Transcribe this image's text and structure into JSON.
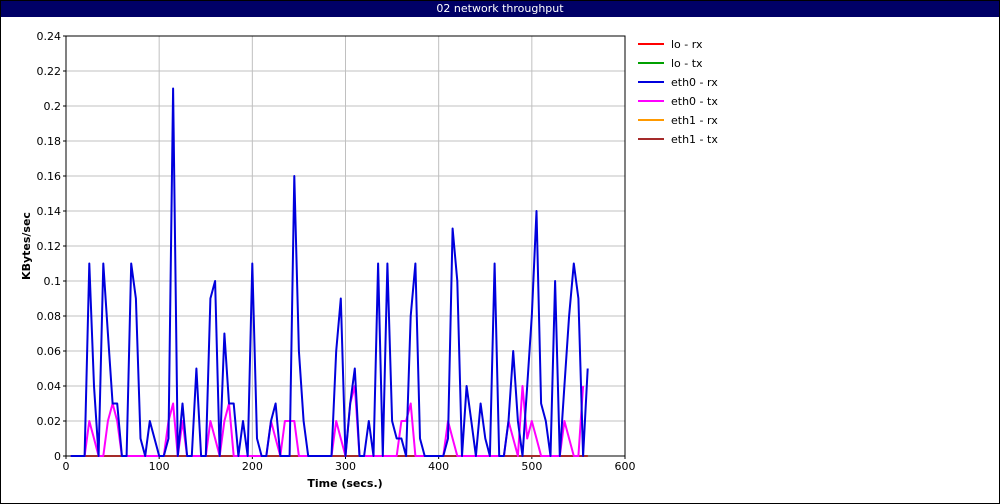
{
  "window": {
    "title": "02 network throughput"
  },
  "chart_data": {
    "type": "line",
    "title": "02 network throughput",
    "xlabel": "Time (secs.)",
    "ylabel": "KBytes/sec",
    "xlim": [
      0,
      600
    ],
    "ylim": [
      0,
      0.24
    ],
    "xticks": [
      0,
      100,
      200,
      300,
      400,
      500,
      600
    ],
    "yticks": [
      0,
      0.02,
      0.04,
      0.06,
      0.08,
      0.1,
      0.12,
      0.14,
      0.16,
      0.18,
      0.2,
      0.22,
      0.24
    ],
    "grid": true,
    "legend_position": "right",
    "x": [
      5,
      10,
      15,
      20,
      25,
      30,
      35,
      40,
      45,
      50,
      55,
      60,
      65,
      70,
      75,
      80,
      85,
      90,
      95,
      100,
      105,
      110,
      115,
      120,
      125,
      130,
      135,
      140,
      145,
      150,
      155,
      160,
      165,
      170,
      175,
      180,
      185,
      190,
      195,
      200,
      205,
      210,
      215,
      220,
      225,
      230,
      235,
      240,
      245,
      250,
      255,
      260,
      265,
      270,
      275,
      280,
      285,
      290,
      295,
      300,
      305,
      310,
      315,
      320,
      325,
      330,
      335,
      340,
      345,
      350,
      355,
      360,
      365,
      370,
      375,
      380,
      385,
      390,
      395,
      400,
      405,
      410,
      415,
      420,
      425,
      430,
      435,
      440,
      445,
      450,
      455,
      460,
      465,
      470,
      475,
      480,
      485,
      490,
      495,
      500,
      505,
      510,
      515,
      520,
      525,
      530,
      535,
      540,
      545,
      550,
      555,
      560
    ],
    "series": [
      {
        "name": "lo - rx",
        "color": "#ff0000",
        "values": [
          0,
          0,
          0,
          0,
          0,
          0,
          0,
          0,
          0,
          0,
          0,
          0,
          0,
          0,
          0,
          0,
          0,
          0,
          0,
          0,
          0,
          0,
          0,
          0,
          0,
          0,
          0,
          0,
          0,
          0,
          0,
          0,
          0,
          0,
          0,
          0,
          0,
          0,
          0,
          0,
          0,
          0,
          0,
          0,
          0,
          0,
          0,
          0,
          0,
          0,
          0,
          0,
          0,
          0,
          0,
          0,
          0,
          0,
          0,
          0,
          0,
          0,
          0,
          0,
          0,
          0,
          0,
          0,
          0,
          0,
          0,
          0,
          0,
          0,
          0,
          0,
          0,
          0,
          0,
          0,
          0,
          0,
          0,
          0,
          0,
          0,
          0,
          0,
          0,
          0,
          0,
          0,
          0,
          0,
          0,
          0,
          0,
          0,
          0,
          0,
          0,
          0,
          0,
          0,
          0,
          0,
          0,
          0,
          0,
          0,
          0,
          0
        ]
      },
      {
        "name": "lo - tx",
        "color": "#00a000",
        "values": [
          0,
          0,
          0,
          0,
          0,
          0,
          0,
          0,
          0,
          0,
          0,
          0,
          0,
          0,
          0,
          0,
          0,
          0,
          0,
          0,
          0,
          0,
          0,
          0,
          0,
          0,
          0,
          0,
          0,
          0,
          0,
          0,
          0,
          0,
          0,
          0,
          0,
          0,
          0,
          0,
          0,
          0,
          0,
          0,
          0,
          0,
          0,
          0,
          0,
          0,
          0,
          0,
          0,
          0,
          0,
          0,
          0,
          0,
          0,
          0,
          0,
          0,
          0,
          0,
          0,
          0,
          0,
          0,
          0,
          0,
          0,
          0,
          0,
          0,
          0,
          0,
          0,
          0,
          0,
          0,
          0,
          0,
          0,
          0,
          0,
          0,
          0,
          0,
          0,
          0,
          0,
          0,
          0,
          0,
          0,
          0,
          0,
          0,
          0,
          0,
          0,
          0,
          0,
          0,
          0,
          0,
          0,
          0,
          0,
          0,
          0,
          0
        ]
      },
      {
        "name": "eth0 - rx",
        "color": "#0000dd",
        "values": [
          0,
          0,
          0,
          0,
          0.11,
          0.04,
          0,
          0.11,
          0.07,
          0.03,
          0.03,
          0,
          0,
          0.11,
          0.09,
          0.01,
          0,
          0.02,
          0.01,
          0,
          0,
          0.01,
          0.21,
          0,
          0.03,
          0,
          0,
          0.05,
          0,
          0,
          0.09,
          0.1,
          0,
          0.07,
          0.03,
          0.03,
          0,
          0.02,
          0,
          0.11,
          0.01,
          0,
          0,
          0.02,
          0.03,
          0,
          0,
          0,
          0.16,
          0.06,
          0.02,
          0,
          0,
          0,
          0,
          0,
          0,
          0.06,
          0.09,
          0,
          0.03,
          0.05,
          0,
          0,
          0.02,
          0,
          0.11,
          0,
          0.11,
          0.02,
          0.01,
          0.01,
          0,
          0.08,
          0.11,
          0.01,
          0,
          0,
          0,
          0,
          0,
          0.01,
          0.13,
          0.1,
          0,
          0.04,
          0.02,
          0,
          0.03,
          0.01,
          0,
          0.11,
          0,
          0,
          0.02,
          0.06,
          0.02,
          0,
          0.04,
          0.08,
          0.14,
          0.03,
          0.02,
          0,
          0.1,
          0,
          0.04,
          0.08,
          0.11,
          0.09,
          0,
          0.05
        ]
      },
      {
        "name": "eth0 - tx",
        "color": "#ff00ff",
        "values": [
          0,
          0,
          0,
          0,
          0.02,
          0.01,
          0,
          0,
          0.02,
          0.03,
          0.02,
          0,
          0,
          0,
          0,
          0,
          0,
          0,
          0,
          0,
          0,
          0.02,
          0.03,
          0,
          0.02,
          0,
          0,
          0,
          0,
          0,
          0.02,
          0.01,
          0,
          0.02,
          0.03,
          0,
          0,
          0,
          0,
          0,
          0,
          0,
          0,
          0.02,
          0.01,
          0,
          0.02,
          0.02,
          0.02,
          0,
          0,
          0,
          0,
          0,
          0,
          0,
          0,
          0.02,
          0.01,
          0,
          0.03,
          0.04,
          0,
          0,
          0,
          0,
          0,
          0,
          0,
          0,
          0,
          0.02,
          0.02,
          0.03,
          0,
          0,
          0,
          0,
          0,
          0,
          0,
          0.02,
          0.01,
          0,
          0,
          0,
          0,
          0,
          0,
          0,
          0,
          0,
          0,
          0,
          0.02,
          0.01,
          0,
          0.04,
          0.01,
          0.02,
          0.01,
          0,
          0,
          0,
          0,
          0,
          0.02,
          0.01,
          0,
          0,
          0.04
        ]
      },
      {
        "name": "eth1 - rx",
        "color": "#ff9900",
        "values": [
          0,
          0,
          0,
          0,
          0,
          0,
          0,
          0,
          0,
          0,
          0,
          0,
          0,
          0,
          0,
          0,
          0,
          0,
          0,
          0,
          0,
          0,
          0,
          0,
          0,
          0,
          0,
          0,
          0,
          0,
          0,
          0,
          0,
          0,
          0,
          0,
          0,
          0,
          0,
          0,
          0,
          0,
          0,
          0,
          0,
          0,
          0,
          0,
          0,
          0,
          0,
          0,
          0,
          0,
          0,
          0,
          0,
          0,
          0,
          0,
          0,
          0,
          0,
          0,
          0,
          0,
          0,
          0,
          0,
          0,
          0,
          0,
          0,
          0,
          0,
          0,
          0,
          0,
          0,
          0,
          0,
          0,
          0,
          0,
          0,
          0,
          0,
          0,
          0,
          0,
          0,
          0,
          0,
          0,
          0,
          0,
          0,
          0,
          0,
          0,
          0,
          0,
          0,
          0,
          0,
          0,
          0,
          0,
          0,
          0,
          0,
          0
        ]
      },
      {
        "name": "eth1 - tx",
        "color": "#a52a2a",
        "values": [
          0,
          0,
          0,
          0,
          0,
          0,
          0,
          0,
          0,
          0,
          0,
          0,
          0,
          0,
          0,
          0,
          0,
          0,
          0,
          0,
          0,
          0,
          0,
          0,
          0,
          0,
          0,
          0,
          0,
          0,
          0,
          0,
          0,
          0,
          0,
          0,
          0,
          0,
          0,
          0,
          0,
          0,
          0,
          0,
          0,
          0,
          0,
          0,
          0,
          0,
          0,
          0,
          0,
          0,
          0,
          0,
          0,
          0,
          0,
          0,
          0,
          0,
          0,
          0,
          0,
          0,
          0,
          0,
          0,
          0,
          0,
          0,
          0,
          0,
          0,
          0,
          0,
          0,
          0,
          0,
          0,
          0,
          0,
          0,
          0,
          0,
          0,
          0,
          0,
          0,
          0,
          0,
          0,
          0,
          0,
          0,
          0,
          0,
          0,
          0,
          0,
          0,
          0,
          0,
          0,
          0,
          0,
          0,
          0,
          0,
          0,
          0
        ]
      }
    ]
  }
}
